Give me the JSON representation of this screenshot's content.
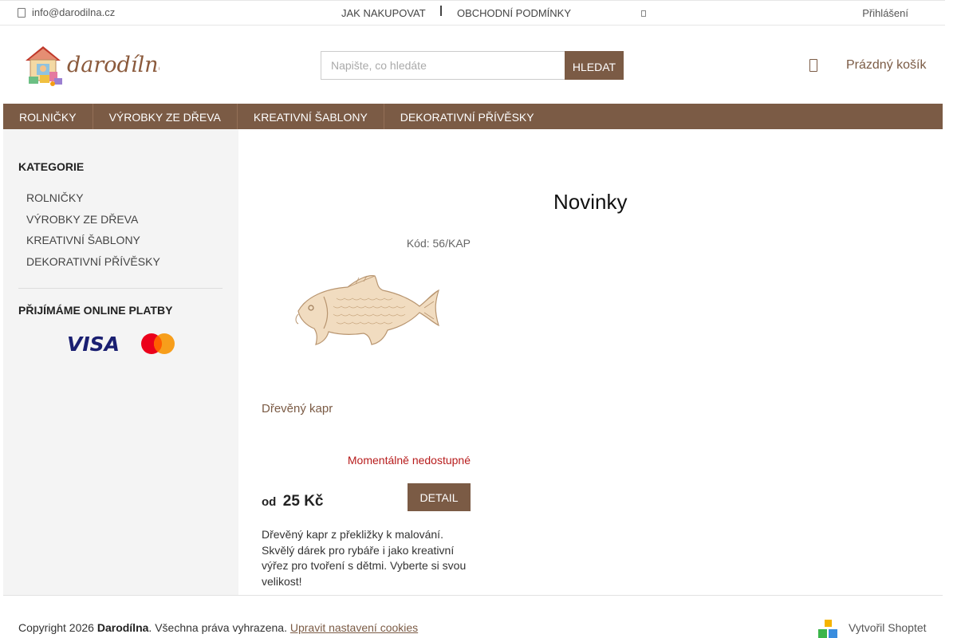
{
  "topbar": {
    "email": "info@darodilna.cz",
    "links": [
      "JAK NAKUPOVAT",
      "OBCHODNÍ PODMÍNKY"
    ],
    "login": "Přihlášení"
  },
  "header": {
    "logo_text": "darodílna",
    "search_placeholder": "Napište, co hledáte",
    "search_button": "HLEDAT",
    "cart_label": "Prázdný košík"
  },
  "nav": {
    "items": [
      "ROLNIČKY",
      "VÝROBKY ZE DŘEVA",
      "KREATIVNÍ ŠABLONY",
      "DEKORATIVNÍ PŘÍVĚSKY"
    ]
  },
  "sidebar": {
    "categories_heading": "KATEGORIE",
    "categories": [
      "ROLNIČKY",
      "VÝROBKY ZE DŘEVA",
      "KREATIVNÍ ŠABLONY",
      "DEKORATIVNÍ PŘÍVĚSKY"
    ],
    "payments_heading": "PŘIJÍMÁME ONLINE PLATBY",
    "payment_logos": [
      "VISA",
      "mastercard"
    ]
  },
  "main": {
    "title": "Novinky",
    "product": {
      "code": "Kód: 56/KAP",
      "name": "Dřevěný kapr",
      "availability": "Momentálně nedostupné",
      "price_prefix": "od",
      "price": "25 Kč",
      "detail_button": "DETAIL",
      "description": "Dřevěný kapr z překližky k malování. Skvělý dárek pro rybáře i jako kreativní výřez pro tvoření s dětmi. Vyberte si svou velikost!"
    }
  },
  "footer": {
    "copyright_prefix": "Copyright 2026 ",
    "brand": "Darodílna",
    "rights": ". Všechna práva vyhrazena. ",
    "cookie_link": "Upravit nastavení cookies",
    "shoptet": "Vytvořil Shoptet"
  },
  "colors": {
    "brand": "#7b5b45",
    "unavailable": "#b71c1c",
    "sidebar_bg": "#f4f4f4"
  }
}
